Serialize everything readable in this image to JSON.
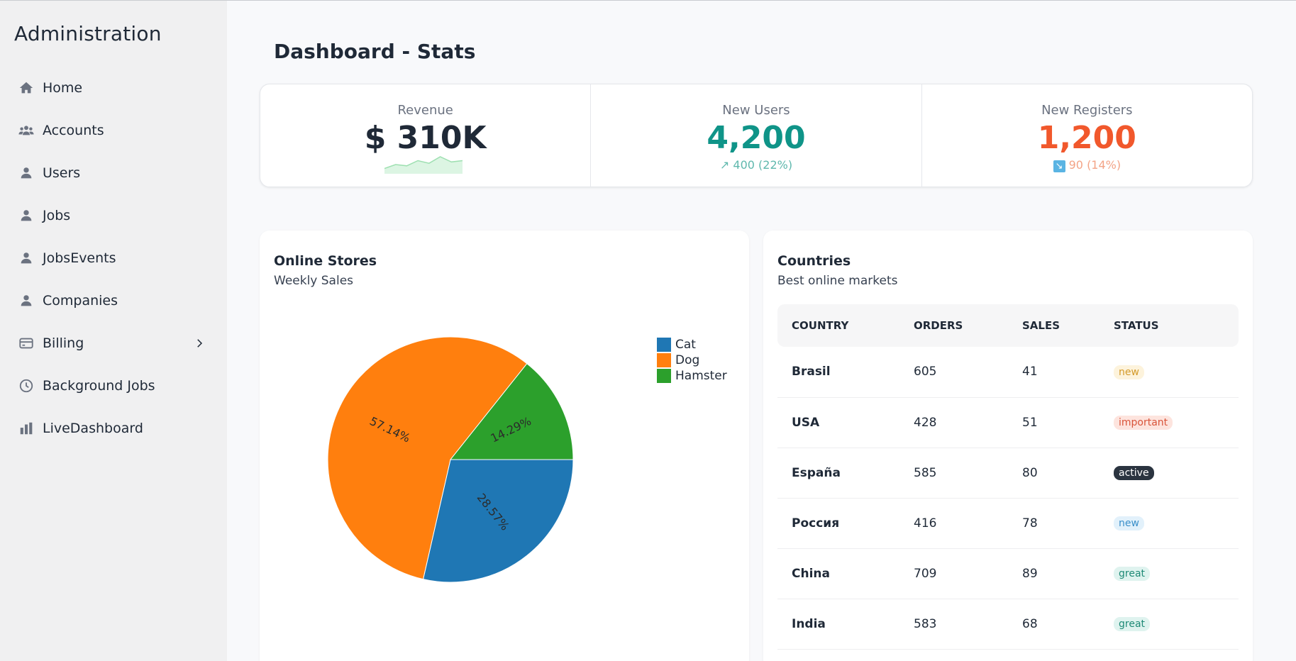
{
  "sidebar": {
    "brand": "Administration",
    "items": [
      {
        "label": "Home",
        "icon": "home-icon"
      },
      {
        "label": "Accounts",
        "icon": "group-icon"
      },
      {
        "label": "Users",
        "icon": "user-icon"
      },
      {
        "label": "Jobs",
        "icon": "user-icon"
      },
      {
        "label": "JobsEvents",
        "icon": "user-icon"
      },
      {
        "label": "Companies",
        "icon": "user-icon"
      },
      {
        "label": "Billing",
        "icon": "credit-card-icon",
        "expandable": true
      },
      {
        "label": "Background Jobs",
        "icon": "clock-icon"
      },
      {
        "label": "LiveDashboard",
        "icon": "bar-chart-icon"
      }
    ]
  },
  "page": {
    "title": "Dashboard - Stats"
  },
  "stats": [
    {
      "title": "Revenue",
      "value": "$ 310K",
      "color": "#1f2937",
      "trend": [
        3,
        6,
        5,
        9,
        7,
        12,
        8,
        9
      ]
    },
    {
      "title": "New Users",
      "value": "4,200",
      "color": "#0f9488",
      "desc": "↗︎ 400 (22%)",
      "desc_color": "#5fb8ad"
    },
    {
      "title": "New Registers",
      "value": "1,200",
      "color": "#f1582c",
      "desc_icon": "↘",
      "desc": " 90 (14%)",
      "desc_color": "#f3a487"
    }
  ],
  "online_stores": {
    "title": "Online Stores",
    "subtitle": "Weekly Sales"
  },
  "chart_data": {
    "type": "pie",
    "categories": [
      "Cat",
      "Dog",
      "Hamster"
    ],
    "values": [
      28.57,
      57.14,
      14.29
    ],
    "labels": [
      "28.57%",
      "57.14%",
      "14.29%"
    ],
    "colors": [
      "#1f77b4",
      "#ff7f0e",
      "#2ca02c"
    ],
    "legend": "top-right"
  },
  "countries": {
    "title": "Countries",
    "subtitle": "Best online markets",
    "columns": [
      "COUNTRY",
      "ORDERS",
      "SALES",
      "STATUS"
    ],
    "rows": [
      {
        "country": "Brasil",
        "orders": "605",
        "sales": "41",
        "status": "new",
        "status_bg": "#fdf3dc",
        "status_color": "#d49a2a"
      },
      {
        "country": "USA",
        "orders": "428",
        "sales": "51",
        "status": "important",
        "status_bg": "#fde4de",
        "status_color": "#d9543a"
      },
      {
        "country": "España",
        "orders": "585",
        "sales": "80",
        "status": "active",
        "status_bg": "#2b3440",
        "status_color": "#ffffff"
      },
      {
        "country": "Россия",
        "orders": "416",
        "sales": "78",
        "status": "new",
        "status_bg": "#e2f1fb",
        "status_color": "#3a8fc9"
      },
      {
        "country": "China",
        "orders": "709",
        "sales": "89",
        "status": "great",
        "status_bg": "#dff3ef",
        "status_color": "#1f8a76"
      },
      {
        "country": "India",
        "orders": "583",
        "sales": "68",
        "status": "great",
        "status_bg": "#dff3ef",
        "status_color": "#1f8a76"
      }
    ]
  }
}
